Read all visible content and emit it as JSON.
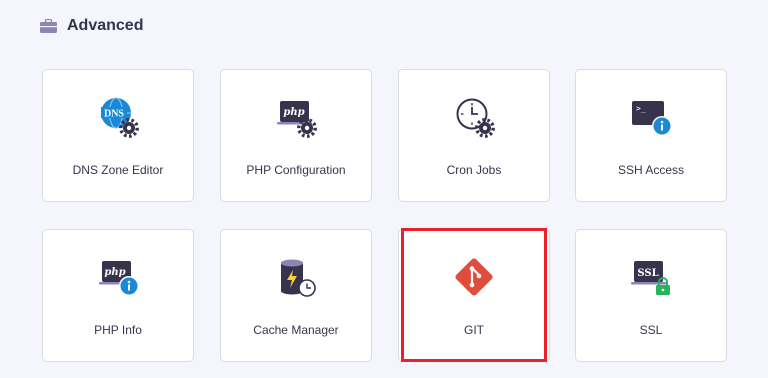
{
  "section": {
    "title": "Advanced",
    "icon": "briefcase-icon"
  },
  "tools": [
    {
      "label": "DNS Zone Editor",
      "icon": "dns-gear-icon",
      "icon_text": "DNS"
    },
    {
      "label": "PHP Configuration",
      "icon": "php-gear-icon",
      "icon_text": "php"
    },
    {
      "label": "Cron Jobs",
      "icon": "clock-gear-icon"
    },
    {
      "label": "SSH Access",
      "icon": "terminal-info-icon",
      "icon_text": ">_"
    },
    {
      "label": "PHP Info",
      "icon": "php-info-icon",
      "icon_text": "php"
    },
    {
      "label": "Cache Manager",
      "icon": "cache-clock-icon"
    },
    {
      "label": "GIT",
      "icon": "git-icon"
    },
    {
      "label": "SSL",
      "icon": "ssl-lock-icon",
      "icon_text": "SSL"
    }
  ],
  "highlighted_tool": "GIT",
  "colors": {
    "highlight": "#e8212b",
    "accent_blue": "#1b88d6",
    "git_red": "#e24c3d",
    "lock_green": "#25b45a",
    "icon_dark": "#36344d"
  }
}
